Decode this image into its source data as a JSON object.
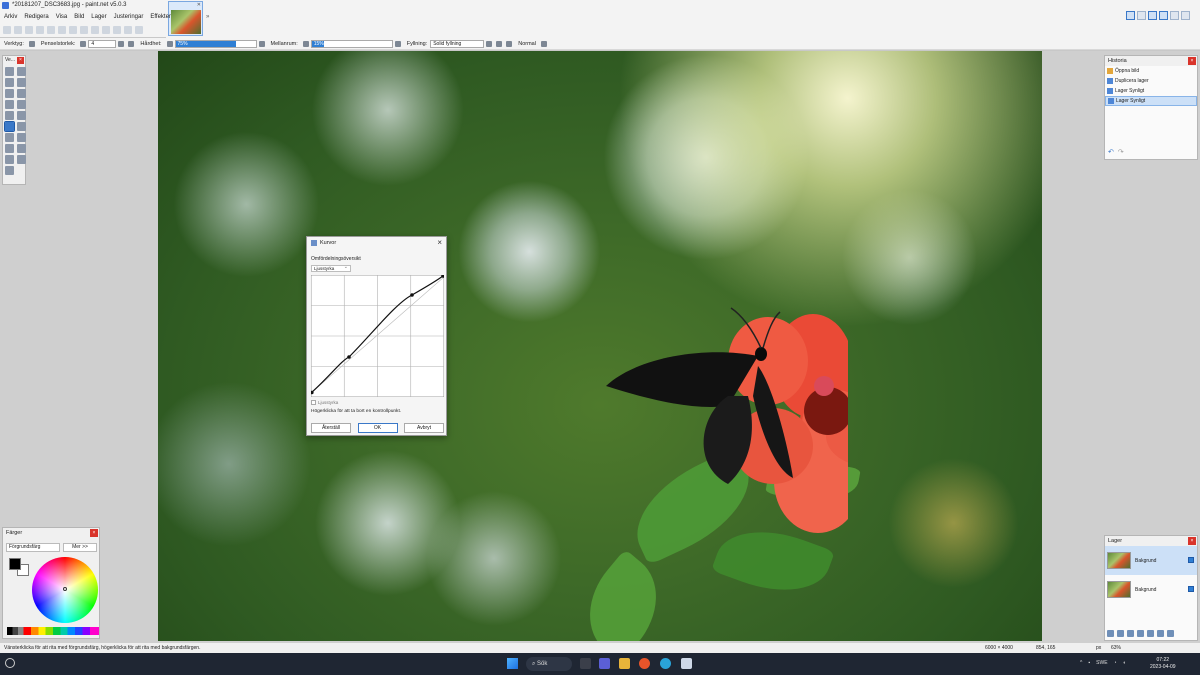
{
  "window": {
    "title": "*20181207_DSC3683.jpg - paint.net v5.0.3"
  },
  "menu": [
    "Arkiv",
    "Redigera",
    "Visa",
    "Bild",
    "Lager",
    "Justeringar",
    "Effekter"
  ],
  "toolbar": {
    "tool_label": "Verktyg:",
    "brush_size_label": "Penselstorlek:",
    "brush_size_value": "4",
    "hardness_label": "Hårdhet:",
    "hardness_value": "75%",
    "hardness_fraction": 0.75,
    "spacing_label": "Mellanrum:",
    "spacing_value": "15%",
    "spacing_fraction": 0.15,
    "fill_label": "Fyllning:",
    "fill_value": "Solid fyllning",
    "blend_value": "Normal"
  },
  "curves_dialog": {
    "title": "Kurvor",
    "section_label": "Omfördelningsöversikt",
    "mode_value": "Ljusstyrka",
    "checkbox_label": "Ljusstyrka",
    "hint": "Högerklicka för att ta bort en kontrollpunkt.",
    "buttons": {
      "reset": "Återställ",
      "ok": "OK",
      "cancel": "Avbryt"
    }
  },
  "tools_panel": {
    "title": "Ve..."
  },
  "colors_panel": {
    "title": "Färger",
    "mode_value": "Förgrundsfärg",
    "more_label": "Mer >>",
    "primary_color": "#000000",
    "secondary_color": "#ffffff"
  },
  "history_panel": {
    "title": "Historia",
    "items": [
      "Öppna bild",
      "Duplicera lager",
      "Lager Synligt",
      "Lager Synligt"
    ]
  },
  "layers_panel": {
    "title": "Lager",
    "items": [
      "Bakgrund",
      "Bakgrund"
    ]
  },
  "statusbar": {
    "hint": "Vänsterklicka för att rita med förgrundsfärg, högerklicka för att rita med bakgrundsfärgen.",
    "image_size": "6000 × 4000",
    "cursor_pos": "854, 165",
    "unit": "px",
    "zoom": "63%"
  },
  "taskbar": {
    "search_label": "Sök",
    "language": "SWE",
    "time": "07:22",
    "date": "2023-04-09"
  }
}
